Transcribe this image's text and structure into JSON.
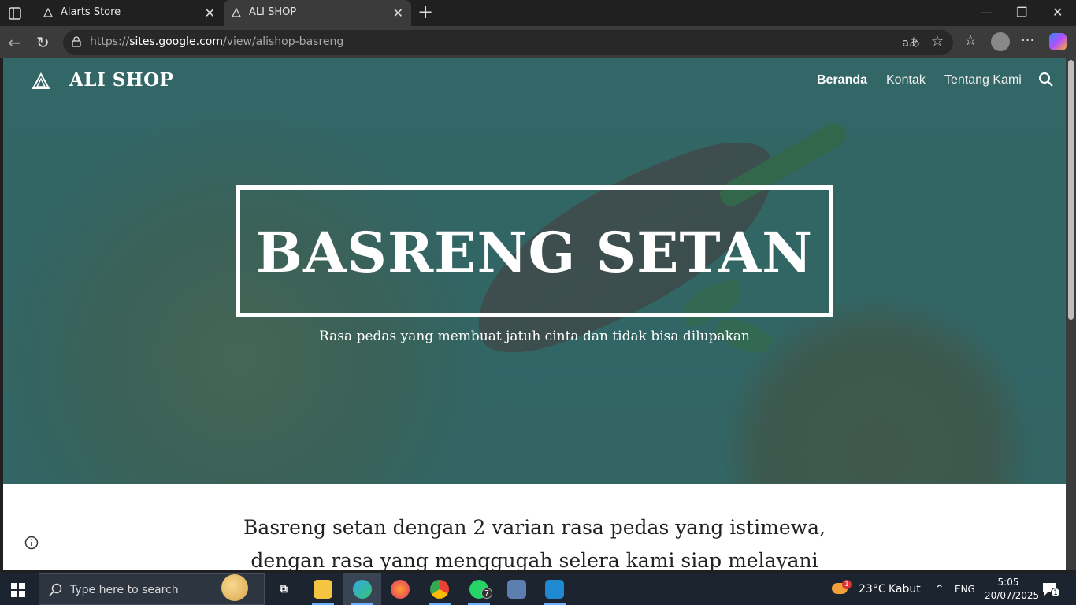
{
  "browser": {
    "tabs": [
      {
        "title": "Alarts Store"
      },
      {
        "title": "ALI SHOP"
      }
    ],
    "url_prefix": "https://",
    "url_host": "sites.google.com",
    "url_path": "/view/alishop-basreng",
    "read_aloud_label": "aあ"
  },
  "site": {
    "brand": "ALI SHOP",
    "nav": [
      {
        "label": "Beranda",
        "active": true
      },
      {
        "label": "Kontak",
        "active": false
      },
      {
        "label": "Tentang Kami",
        "active": false
      }
    ],
    "hero_title": "BASRENG SETAN",
    "hero_subtitle": "Rasa pedas yang membuat jatuh cinta dan tidak bisa dilupakan",
    "intro_line1": "Basreng setan dengan 2 varian rasa pedas yang istimewa,",
    "intro_line2": "dengan rasa yang menggugah selera kami siap melayani"
  },
  "taskbar": {
    "search_placeholder": "Type here to search",
    "whatsapp_badge": "7",
    "weather_badge": "1",
    "temperature": "23°C",
    "weather": "Kabut",
    "language": "ENG",
    "time": "5:05",
    "date": "20/07/2025",
    "notification_count": "1"
  },
  "colors": {
    "hero_overlay": "#2f6a6a",
    "browser_chrome": "#202020",
    "taskbar": "#1c2430"
  }
}
